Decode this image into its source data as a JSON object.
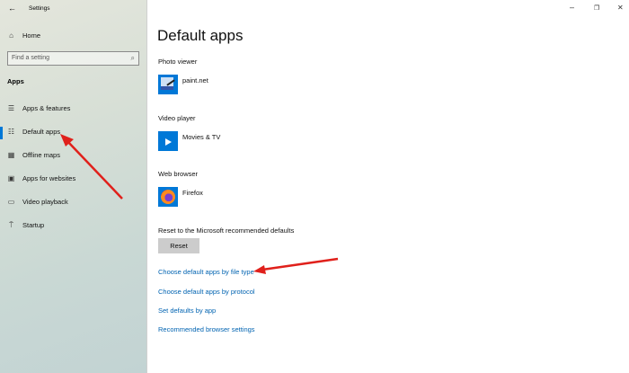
{
  "window": {
    "title": "Settings",
    "back": "←",
    "minimize": "–",
    "restore": "❐",
    "close": "✕"
  },
  "sidebar": {
    "home": "Home",
    "search_placeholder": "Find a setting",
    "section": "Apps",
    "items": [
      {
        "label": "Apps & features",
        "icon": "list-icon"
      },
      {
        "label": "Default apps",
        "icon": "default-apps-icon",
        "selected": true
      },
      {
        "label": "Offline maps",
        "icon": "map-icon"
      },
      {
        "label": "Apps for websites",
        "icon": "web-app-icon"
      },
      {
        "label": "Video playback",
        "icon": "video-icon"
      },
      {
        "label": "Startup",
        "icon": "startup-icon"
      }
    ]
  },
  "main": {
    "title": "Default apps",
    "defaults": [
      {
        "category": "Photo viewer",
        "app": "paint.net"
      },
      {
        "category": "Video player",
        "app": "Movies & TV"
      },
      {
        "category": "Web browser",
        "app": "Firefox"
      }
    ],
    "reset_label": "Reset to the Microsoft recommended defaults",
    "reset_button": "Reset",
    "links": [
      "Choose default apps by file type",
      "Choose default apps by protocol",
      "Set defaults by app",
      "Recommended browser settings"
    ]
  },
  "colors": {
    "accent": "#0078d7",
    "link": "#0063b1",
    "annotation_arrow": "#e0201b"
  }
}
